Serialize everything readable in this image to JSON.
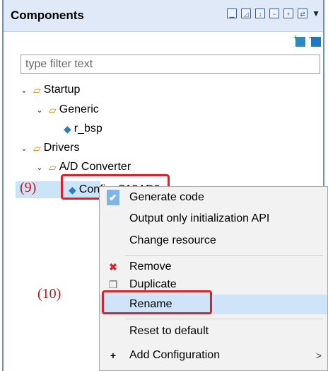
{
  "panel": {
    "title": "Components"
  },
  "toolbar_icons": [
    "collapse-icon",
    "expand-icon",
    "sort-icon",
    "minus-box-icon",
    "plus-box-icon",
    "link-icon",
    "view-menu-icon"
  ],
  "filter": {
    "placeholder": "type filter text",
    "value": ""
  },
  "tree": {
    "startup": "Startup",
    "generic": "Generic",
    "r_bsp": "r_bsp",
    "drivers": "Drivers",
    "ad_converter": "A/D Converter",
    "config": "Config_S12AD0"
  },
  "annotations": {
    "label9": "(9)",
    "label10": "(10)"
  },
  "menu": {
    "generate": "Generate code",
    "output_init": "Output only initialization API",
    "change_resource": "Change resource",
    "remove": "Remove",
    "duplicate": "Duplicate",
    "rename": "Rename",
    "reset": "Reset to default",
    "add_config": "Add Configuration",
    "submenu_arrow": ">"
  },
  "colors": {
    "accent": "#6b8fc5",
    "highlight": "#cfe4f8",
    "annotation_red": "#e01e26"
  }
}
